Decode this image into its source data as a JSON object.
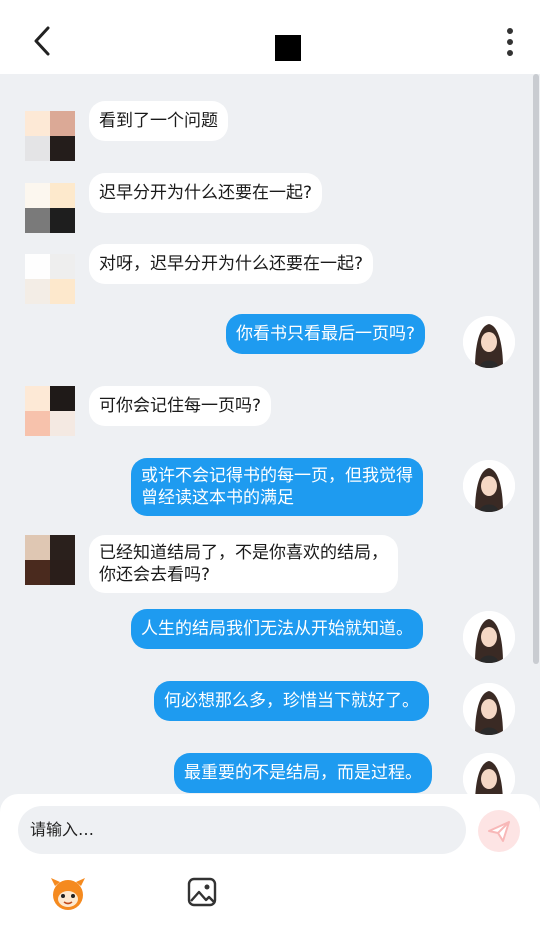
{
  "header": {
    "back_icon": "back-arrow-icon",
    "more_icon": "more-vertical-icon"
  },
  "messages": [
    {
      "side": "left",
      "text": "看到了一个问题"
    },
    {
      "side": "left",
      "text": "迟早分开为什么还要在一起?"
    },
    {
      "side": "left",
      "text": "对呀，迟早分开为什么还要在一起?"
    },
    {
      "side": "right",
      "text": "你看书只看最后一页吗?"
    },
    {
      "side": "left",
      "text": "可你会记住每一页吗?"
    },
    {
      "side": "right",
      "line1": "或许不会记得书的每一页，但我觉得",
      "line2": "曾经读这本书的满足"
    },
    {
      "side": "left",
      "line1": "已经知道结局了，不是你喜欢的结局，",
      "line2": "你还会去看吗?"
    },
    {
      "side": "right",
      "text": "人生的结局我们无法从开始就知道。"
    },
    {
      "side": "right",
      "text": "何必想那么多，珍惜当下就好了。"
    },
    {
      "side": "right",
      "text": "最重要的不是结局，而是过程。"
    }
  ],
  "composer": {
    "placeholder": "请输入…",
    "send_icon": "send-icon",
    "tools": [
      "mascot-icon",
      "image-icon"
    ]
  },
  "colors": {
    "right_bubble": "#1e9bf0",
    "background": "#eef0f3"
  }
}
